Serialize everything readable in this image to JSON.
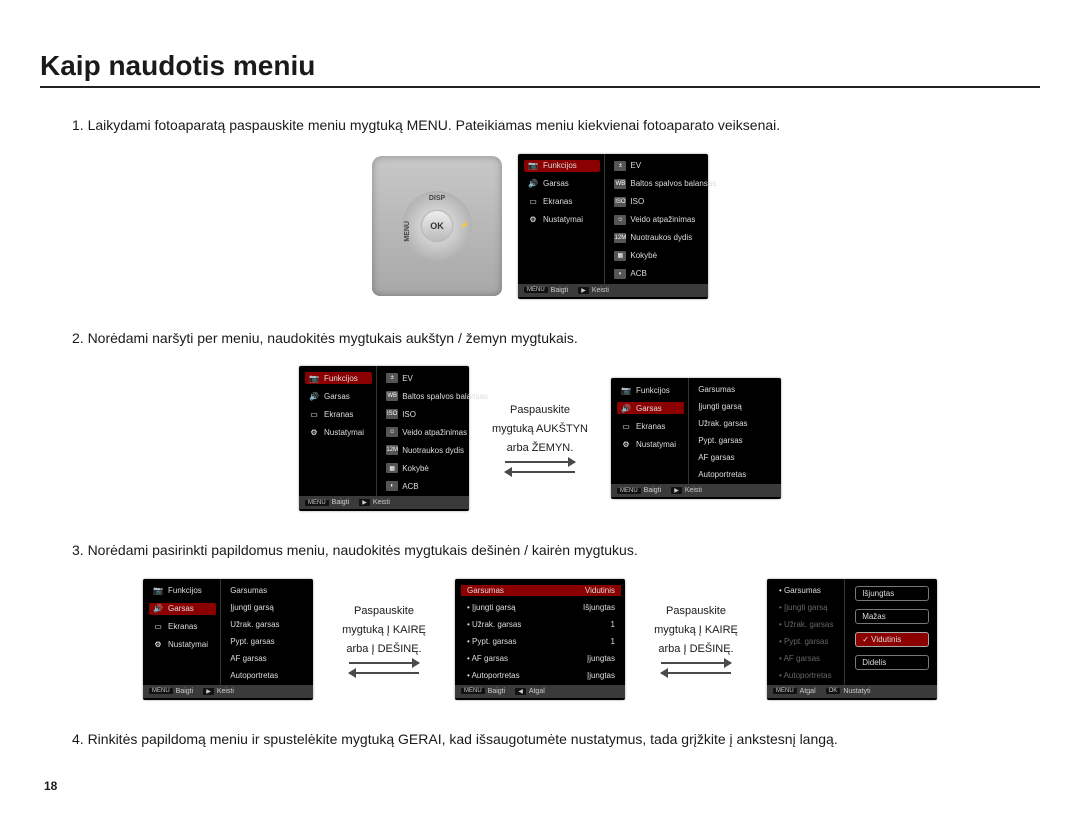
{
  "title": "Kaip naudotis meniu",
  "page_number": "18",
  "steps": {
    "s1": "1. Laikydami fotoaparatą paspauskite meniu mygtuką MENU. Pateikiamas meniu kiekvienai fotoaparato veiksenai.",
    "s2": "2. Norėdami naršyti per meniu, naudokitės mygtukais aukštyn / žemyn mygtukais.",
    "s3": "3. Norėdami pasirinkti papildomus meniu, naudokitės mygtukais dešinėn / kairėn mygtukus.",
    "s4": "4. Rinkitės papildomą meniu ir spustelėkite mygtuką GERAI, kad išsaugotumėte nustatymus, tada grįžkite į ankstesnį langą."
  },
  "device": {
    "menu": "MENU",
    "disp": "DISP",
    "ok": "OK"
  },
  "captions": {
    "updown_l1": "Paspauskite",
    "updown_l2": "mygtuką AUKŠTYN",
    "updown_l3": "arba ŽEMYN.",
    "lr_l1": "Paspauskite",
    "lr_l2": "mygtuką Į KAIRĘ",
    "lr_l3": "arba Į DEŠINĘ."
  },
  "menuA": {
    "left": [
      "Funkcijos",
      "Garsas",
      "Ekranas",
      "Nustatymai"
    ],
    "right": [
      "EV",
      "Baltos spalvos balansas",
      "ISO",
      "Veido atpažinimas",
      "Nuotraukos dydis",
      "Kokybė",
      "ACB"
    ],
    "right_tag": "12M",
    "footer_l": "Baigti",
    "footer_r": "Keisti",
    "ftag_l": "MENU",
    "ftag_r": "▶"
  },
  "menuB_left": [
    "Funkcijos",
    "Garsas",
    "Ekranas",
    "Nustatymai"
  ],
  "menuB_right": [
    "Garsumas",
    "Įjungti garsą",
    "Užrak. garsas",
    "Pypt. garsas",
    "AF garsas",
    "Autoportretas"
  ],
  "menuB_footer_l": "Baigti",
  "menuB_footer_r": "Keisti",
  "menuC_rows": [
    {
      "k": "Garsumas",
      "v": "Vidutinis"
    },
    {
      "k": "Įjungti garsą",
      "v": "Išjungtas"
    },
    {
      "k": "Užrak. garsas",
      "v": "1"
    },
    {
      "k": "Pypt. garsas",
      "v": "1"
    },
    {
      "k": "AF garsas",
      "v": "Įjungtas"
    },
    {
      "k": "Autoportretas",
      "v": "Įjungtas"
    }
  ],
  "menuC_footer_l": "Baigti",
  "menuC_footer_r": "Atgal",
  "menuC_ftag_r": "◀",
  "menuD_left": [
    "Garsumas",
    "Įjungti garsą",
    "Užrak. garsas",
    "Pypt. garsas",
    "AF garsas",
    "Autoportretas"
  ],
  "menuD_right": [
    "Išjungtas",
    "Mažas",
    "Vidutinis",
    "Didelis"
  ],
  "menuD_footer_l": "Atgal",
  "menuD_footer_r": "Nustatyti",
  "menuD_ftag_l": "MENU",
  "menuD_ftag_r": "OK"
}
